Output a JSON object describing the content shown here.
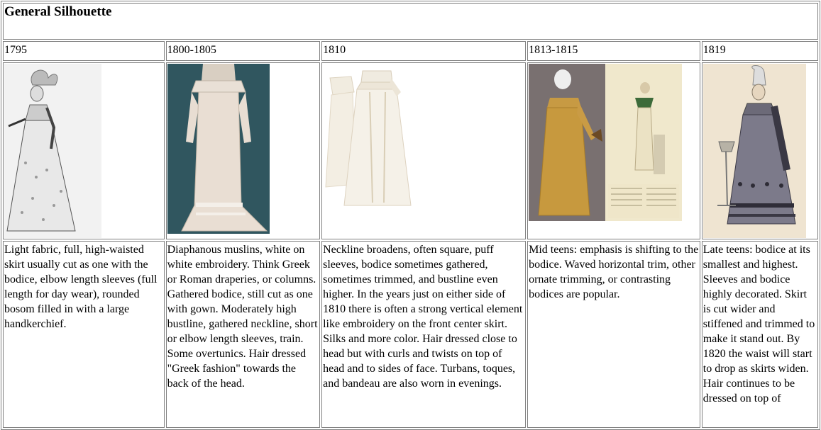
{
  "page": {
    "title": "General Silhouette"
  },
  "columns": [
    {
      "year": "1795",
      "image_name": "1795-fashion-plate",
      "description": "Light fabric, full, high-waisted skirt usually cut as one with the bodice, elbow length sleeves (full length for day wear), rounded bosom filled in with a large handkerchief."
    },
    {
      "year": "1800-1805",
      "image_name": "1800-1805-muslin-gown",
      "description": "Diaphanous muslins, white on white embroidery. Think Greek or Roman draperies, or columns. Gathered bodice, still cut as one with gown. Moderately high bustline, gathered neckline, short or elbow length sleeves, train. Some overtunics. Hair dressed \"Greek fashion\" towards the back of the head."
    },
    {
      "year": "1810",
      "image_name": "1810-white-gown",
      "description": "Neckline broadens, often square, puff sleeves, bodice sometimes gathered, sometimes trimmed, and bustline even higher. In the years just on either side of 1810 there is often a strong vertical element like embroidery on the front center skirt. Silks and more color. Hair dressed close to head but with curls and twists on top of head and to sides of face. Turbans, toques, and bandeau are also worn in evenings."
    },
    {
      "year": "1813-1815",
      "image_name": "1813-1815-gold-silk-gown-and-plate",
      "description": "Mid teens: emphasis is shifting to the bodice. Waved horizontal trim, other ornate trimming, or contrasting bodices are popular."
    },
    {
      "year": "1819",
      "image_name": "1819-fashion-plate",
      "description": "Late teens: bodice at its smallest and highest. Sleeves and bodice highly decorated. Skirt is cut wider and stiffened and trimmed to make it stand out. By 1820 the waist will start to drop as skirts widen. Hair continues to be dressed on top of"
    }
  ]
}
